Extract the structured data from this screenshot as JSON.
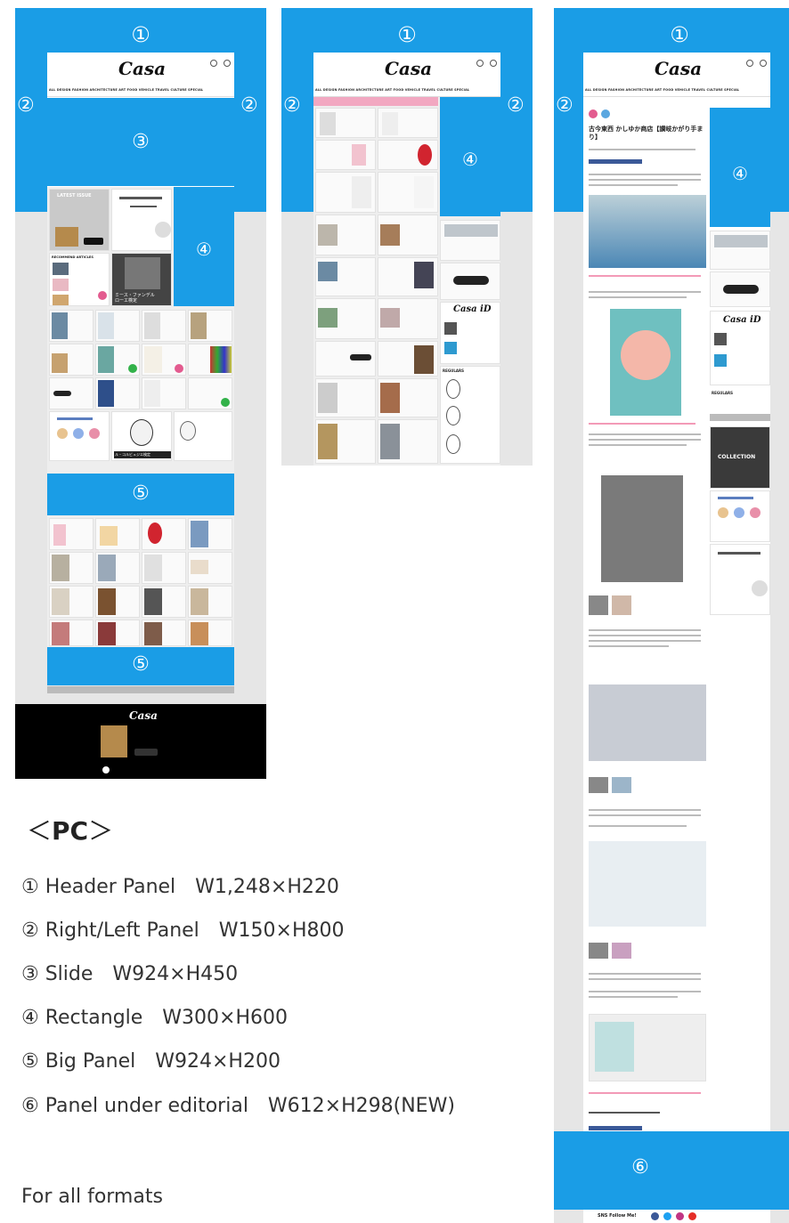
{
  "panel_labels": {
    "one": "①",
    "two": "②",
    "three": "③",
    "four": "④",
    "five": "⑤",
    "six": "⑥"
  },
  "site": {
    "logo": "Casa",
    "logo_sup": "BRUTUS",
    "nav": "ALL  DESIGN  FASHION  ARCHITECTURE  ART  FOOD  VEHICLE  TRAVEL  CULTURE  SPECIAL",
    "latest_issue": "LATEST ISSUE",
    "recommend": "RECOMMEND ARTICLES",
    "regulars": "REGULARS",
    "more": "MORE",
    "collection": "COLLECTION",
    "casa_id": "Casa iD",
    "sns": "SNS Follow Me!",
    "mies": "ミース・ファンデル\nローエ検定",
    "corbusier": "ル・コルビュジエ検定",
    "article_title": "古今東西 かしゆか商店【讃岐かがり手まり】",
    "app_store": "App Store",
    "footer_logo": "Casa"
  },
  "legend": {
    "title_open": "＜",
    "title": "PC",
    "title_close": "＞",
    "items": [
      "① Header Panel　W1,248×H220",
      "② Right/Left Panel　W150×H800",
      "③ Slide　W924×H450",
      "④ Rectangle　W300×H600",
      "⑤ Big Panel　W924×H200",
      "⑥ Panel under editorial　W612×H298(NEW)"
    ],
    "footer": "For all formats"
  },
  "colors": {
    "ad_blue": "#1a9de6",
    "page_gray": "#e6e6e6",
    "footer_black": "#000000"
  }
}
